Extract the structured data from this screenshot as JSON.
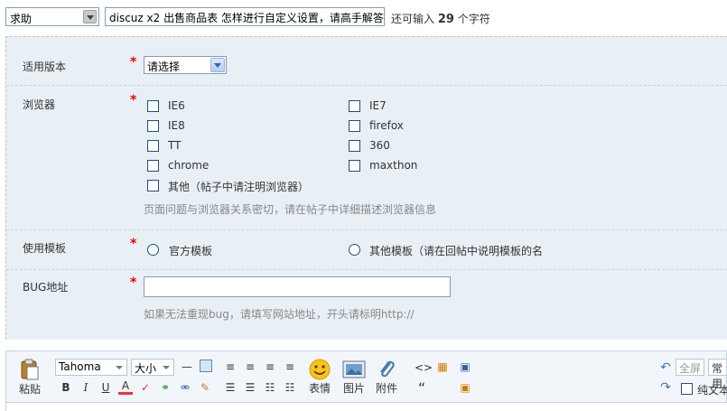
{
  "top": {
    "category": "求助",
    "title_value": "discuz x2 出售商品表 怎样进行自定义设置，请高手解答",
    "hint_prefix": "还可输入",
    "remaining": "29",
    "hint_suffix": "个字符"
  },
  "form": {
    "required_mark": "*",
    "version": {
      "label": "适用版本",
      "selected": "请选择"
    },
    "browser": {
      "label": "浏览器",
      "options": [
        "IE6",
        "IE7",
        "IE8",
        "firefox",
        "TT",
        "360",
        "chrome",
        "maxthon",
        "其他（帖子中请注明浏览器）"
      ],
      "hint": "页面问题与浏览器关系密切，请在帖子中详细描述浏览器信息"
    },
    "template": {
      "label": "使用模板",
      "options": [
        "官方模板",
        "其他模板（请在回帖中说明模板的名"
      ]
    },
    "bug": {
      "label": "BUG地址",
      "value": "",
      "hint": "如果无法重现bug，请填写网站地址，开头请标明http://"
    }
  },
  "editor": {
    "paste": "粘贴",
    "font": "Tahoma",
    "size": "大小",
    "emoji": "表情",
    "image": "图片",
    "attach": "附件",
    "fullscreen": "全屏",
    "common": "常用",
    "plaintext": "纯文本",
    "bold": "B",
    "italic": "I",
    "underline": "U",
    "quote": "“",
    "code": "<>",
    "colors": {
      "accent": "#3a5fa8",
      "panel": "#e8eff5",
      "required": "#e00000"
    }
  }
}
